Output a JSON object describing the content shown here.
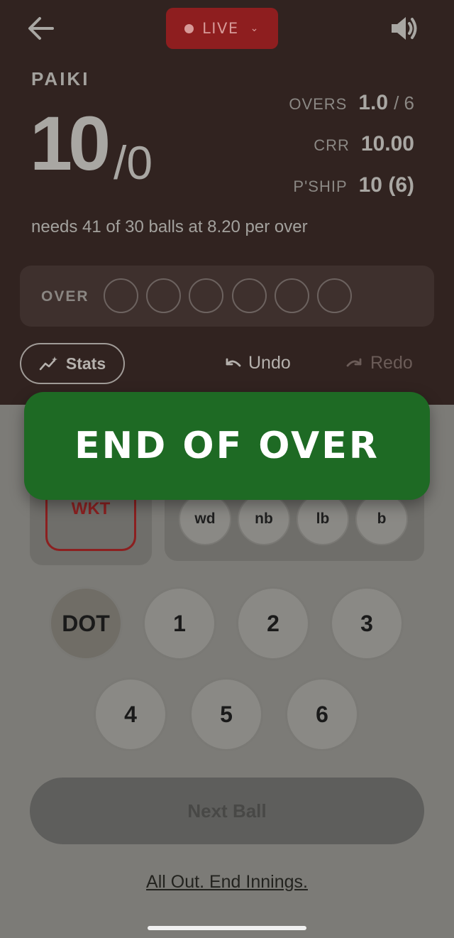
{
  "header": {
    "live_label": "LIVE",
    "team": "PAIKI",
    "runs": "10",
    "wickets": "/0",
    "overs_label": "OVERS",
    "overs_value": "1.0",
    "overs_total": "/ 6",
    "crr_label": "CRR",
    "crr_value": "10.00",
    "pship_label": "P'SHIP",
    "pship_value": "10 (6)",
    "needs_text": "needs 41 of 30 balls at 8.20 per over"
  },
  "over_tracker": {
    "label": "OVER",
    "balls": [
      "",
      "",
      "",
      "",
      "",
      ""
    ]
  },
  "actions": {
    "stats_label": "Stats",
    "undo_label": "Undo",
    "redo_label": "Redo"
  },
  "banner": {
    "text": "END OF OVER",
    "color": "#1e6a24"
  },
  "scoring": {
    "wicket_label": "WKT",
    "extras": [
      "wd",
      "nb",
      "lb",
      "b"
    ],
    "runs": [
      "DOT",
      "1",
      "2",
      "3",
      "4",
      "5",
      "6"
    ]
  },
  "footer": {
    "next_ball_label": "Next Ball",
    "all_out_label": "All Out. End Innings."
  },
  "colors": {
    "header_bg": "#312320",
    "live_bg": "#8e1e1f",
    "wicket": "#8c2020"
  }
}
